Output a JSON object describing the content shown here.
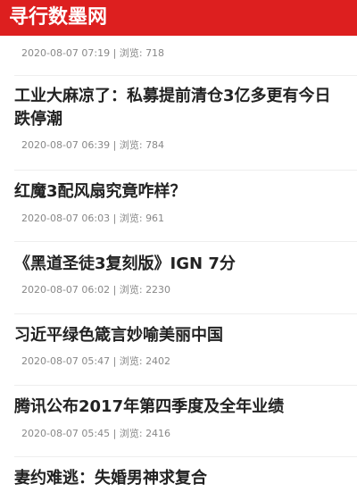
{
  "header": {
    "logo_text": "寻行数墨网",
    "brand_color": "#dd1f1f"
  },
  "articles": [
    {
      "title": "",
      "date": "2020-08-07 07:19",
      "separator": "|",
      "views_label": "浏览:",
      "views": "718"
    },
    {
      "title": "工业大麻凉了：私募提前清仓3亿多更有今日跌停潮",
      "date": "2020-08-07 06:39",
      "separator": "|",
      "views_label": "浏览:",
      "views": "784"
    },
    {
      "title": "红魔3配风扇究竟咋样？",
      "date": "2020-08-07 06:03",
      "separator": "|",
      "views_label": "浏览:",
      "views": "961"
    },
    {
      "title": "《黑道圣徒3复刻版》IGN 7分",
      "date": "2020-08-07 06:02",
      "separator": "|",
      "views_label": "浏览:",
      "views": "2230"
    },
    {
      "title": "习近平绿色箴言妙喻美丽中国",
      "date": "2020-08-07 05:47",
      "separator": "|",
      "views_label": "浏览:",
      "views": "2402"
    },
    {
      "title": "腾讯公布2017年第四季度及全年业绩",
      "date": "2020-08-07 05:45",
      "separator": "|",
      "views_label": "浏览:",
      "views": "2416"
    },
    {
      "title": "妻约难逃：失婚男神求复合",
      "date": "",
      "separator": "",
      "views_label": "",
      "views": ""
    }
  ]
}
